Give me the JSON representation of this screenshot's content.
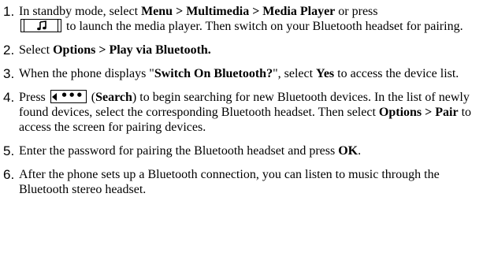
{
  "steps": [
    {
      "number": "1.",
      "t1": "In standby mode, select ",
      "b1": "Menu > Multimedia > Media Player",
      "t2": " or press",
      "t3": " to launch the media player. Then switch on your Bluetooth headset for pairing.",
      "icon": "music-note-key-icon"
    },
    {
      "number": "2.",
      "t1": "Select ",
      "b1": "Options > Play via Bluetooth."
    },
    {
      "number": "3.",
      "t1": "When the phone displays \"",
      "b1": "Switch On Bluetooth?",
      "t2": "\", select ",
      "b2": "Yes",
      "t3": " to access the device list."
    },
    {
      "number": "4.",
      "t1": "Press ",
      "icon": "soft-key-dots-icon",
      "t2": " (",
      "b1": "Search",
      "t3": ") to begin searching for new Bluetooth devices. In the list of newly found devices, select the corresponding Bluetooth headset. Then select ",
      "b2": "Options > Pair",
      "t4": " to access the screen for pairing devices."
    },
    {
      "number": "5.",
      "t1": "Enter the password for pairing the Bluetooth headset and press ",
      "b1": "OK",
      "t2": "."
    },
    {
      "number": "6.",
      "t1": "After the phone sets up a Bluetooth connection, you can listen to music through the Bluetooth stereo headset."
    }
  ]
}
